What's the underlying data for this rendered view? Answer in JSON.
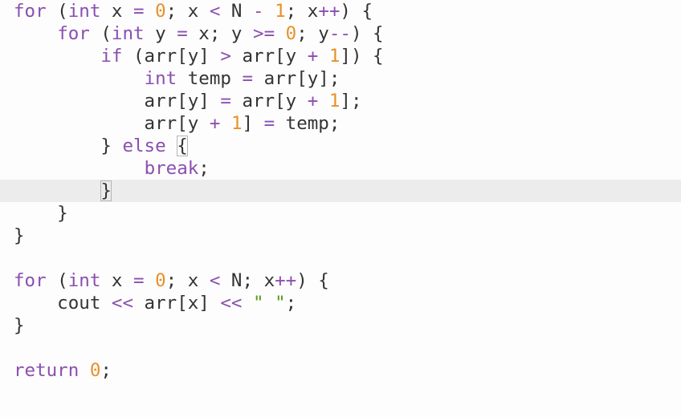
{
  "editor": {
    "active_line": 8,
    "colors": {
      "background": "#fdfdfd",
      "active_line": "#ececec",
      "keyword": "#8a4fb0",
      "number": "#e8902a",
      "string": "#5b9a23",
      "text": "#333333"
    },
    "lines": [
      [
        {
          "t": "for",
          "c": "kw"
        },
        {
          "t": " (",
          "c": "plain"
        },
        {
          "t": "int",
          "c": "kw"
        },
        {
          "t": " x ",
          "c": "plain"
        },
        {
          "t": "=",
          "c": "op"
        },
        {
          "t": " ",
          "c": "plain"
        },
        {
          "t": "0",
          "c": "num"
        },
        {
          "t": "; x ",
          "c": "plain"
        },
        {
          "t": "<",
          "c": "op"
        },
        {
          "t": " N ",
          "c": "plain"
        },
        {
          "t": "-",
          "c": "op"
        },
        {
          "t": " ",
          "c": "plain"
        },
        {
          "t": "1",
          "c": "num"
        },
        {
          "t": "; x",
          "c": "plain"
        },
        {
          "t": "++",
          "c": "op"
        },
        {
          "t": ") {",
          "c": "plain"
        }
      ],
      [
        {
          "t": "    ",
          "c": "plain"
        },
        {
          "t": "for",
          "c": "kw"
        },
        {
          "t": " (",
          "c": "plain"
        },
        {
          "t": "int",
          "c": "kw"
        },
        {
          "t": " y ",
          "c": "plain"
        },
        {
          "t": "=",
          "c": "op"
        },
        {
          "t": " x; y ",
          "c": "plain"
        },
        {
          "t": ">=",
          "c": "op"
        },
        {
          "t": " ",
          "c": "plain"
        },
        {
          "t": "0",
          "c": "num"
        },
        {
          "t": "; y",
          "c": "plain"
        },
        {
          "t": "--",
          "c": "op"
        },
        {
          "t": ") {",
          "c": "plain"
        }
      ],
      [
        {
          "t": "        ",
          "c": "plain"
        },
        {
          "t": "if",
          "c": "kw"
        },
        {
          "t": " (arr[y] ",
          "c": "plain"
        },
        {
          "t": ">",
          "c": "op"
        },
        {
          "t": " arr[y ",
          "c": "plain"
        },
        {
          "t": "+",
          "c": "op"
        },
        {
          "t": " ",
          "c": "plain"
        },
        {
          "t": "1",
          "c": "num"
        },
        {
          "t": "]) {",
          "c": "plain"
        }
      ],
      [
        {
          "t": "            ",
          "c": "plain"
        },
        {
          "t": "int",
          "c": "kw"
        },
        {
          "t": " temp ",
          "c": "plain"
        },
        {
          "t": "=",
          "c": "op"
        },
        {
          "t": " arr[y];",
          "c": "plain"
        }
      ],
      [
        {
          "t": "            arr[y] ",
          "c": "plain"
        },
        {
          "t": "=",
          "c": "op"
        },
        {
          "t": " arr[y ",
          "c": "plain"
        },
        {
          "t": "+",
          "c": "op"
        },
        {
          "t": " ",
          "c": "plain"
        },
        {
          "t": "1",
          "c": "num"
        },
        {
          "t": "];",
          "c": "plain"
        }
      ],
      [
        {
          "t": "            arr[y ",
          "c": "plain"
        },
        {
          "t": "+",
          "c": "op"
        },
        {
          "t": " ",
          "c": "plain"
        },
        {
          "t": "1",
          "c": "num"
        },
        {
          "t": "] ",
          "c": "plain"
        },
        {
          "t": "=",
          "c": "op"
        },
        {
          "t": " temp;",
          "c": "plain"
        }
      ],
      [
        {
          "t": "        } ",
          "c": "plain"
        },
        {
          "t": "else",
          "c": "kw"
        },
        {
          "t": " ",
          "c": "plain"
        },
        {
          "t": "{",
          "c": "plain",
          "m": true
        }
      ],
      [
        {
          "t": "            ",
          "c": "plain"
        },
        {
          "t": "break",
          "c": "kw"
        },
        {
          "t": ";",
          "c": "plain"
        }
      ],
      [
        {
          "t": "        ",
          "c": "plain"
        },
        {
          "t": "}",
          "c": "plain",
          "m": true
        }
      ],
      [
        {
          "t": "    }",
          "c": "plain"
        }
      ],
      [
        {
          "t": "}",
          "c": "plain"
        }
      ],
      [],
      [
        {
          "t": "for",
          "c": "kw"
        },
        {
          "t": " (",
          "c": "plain"
        },
        {
          "t": "int",
          "c": "kw"
        },
        {
          "t": " x ",
          "c": "plain"
        },
        {
          "t": "=",
          "c": "op"
        },
        {
          "t": " ",
          "c": "plain"
        },
        {
          "t": "0",
          "c": "num"
        },
        {
          "t": "; x ",
          "c": "plain"
        },
        {
          "t": "<",
          "c": "op"
        },
        {
          "t": " N; x",
          "c": "plain"
        },
        {
          "t": "++",
          "c": "op"
        },
        {
          "t": ") {",
          "c": "plain"
        }
      ],
      [
        {
          "t": "    cout ",
          "c": "plain"
        },
        {
          "t": "<<",
          "c": "op"
        },
        {
          "t": " arr[x] ",
          "c": "plain"
        },
        {
          "t": "<<",
          "c": "op"
        },
        {
          "t": " ",
          "c": "plain"
        },
        {
          "t": "\" \"",
          "c": "str"
        },
        {
          "t": ";",
          "c": "plain"
        }
      ],
      [
        {
          "t": "}",
          "c": "plain"
        }
      ],
      [],
      [
        {
          "t": "return",
          "c": "kw"
        },
        {
          "t": " ",
          "c": "plain"
        },
        {
          "t": "0",
          "c": "num"
        },
        {
          "t": ";",
          "c": "plain"
        }
      ]
    ]
  }
}
